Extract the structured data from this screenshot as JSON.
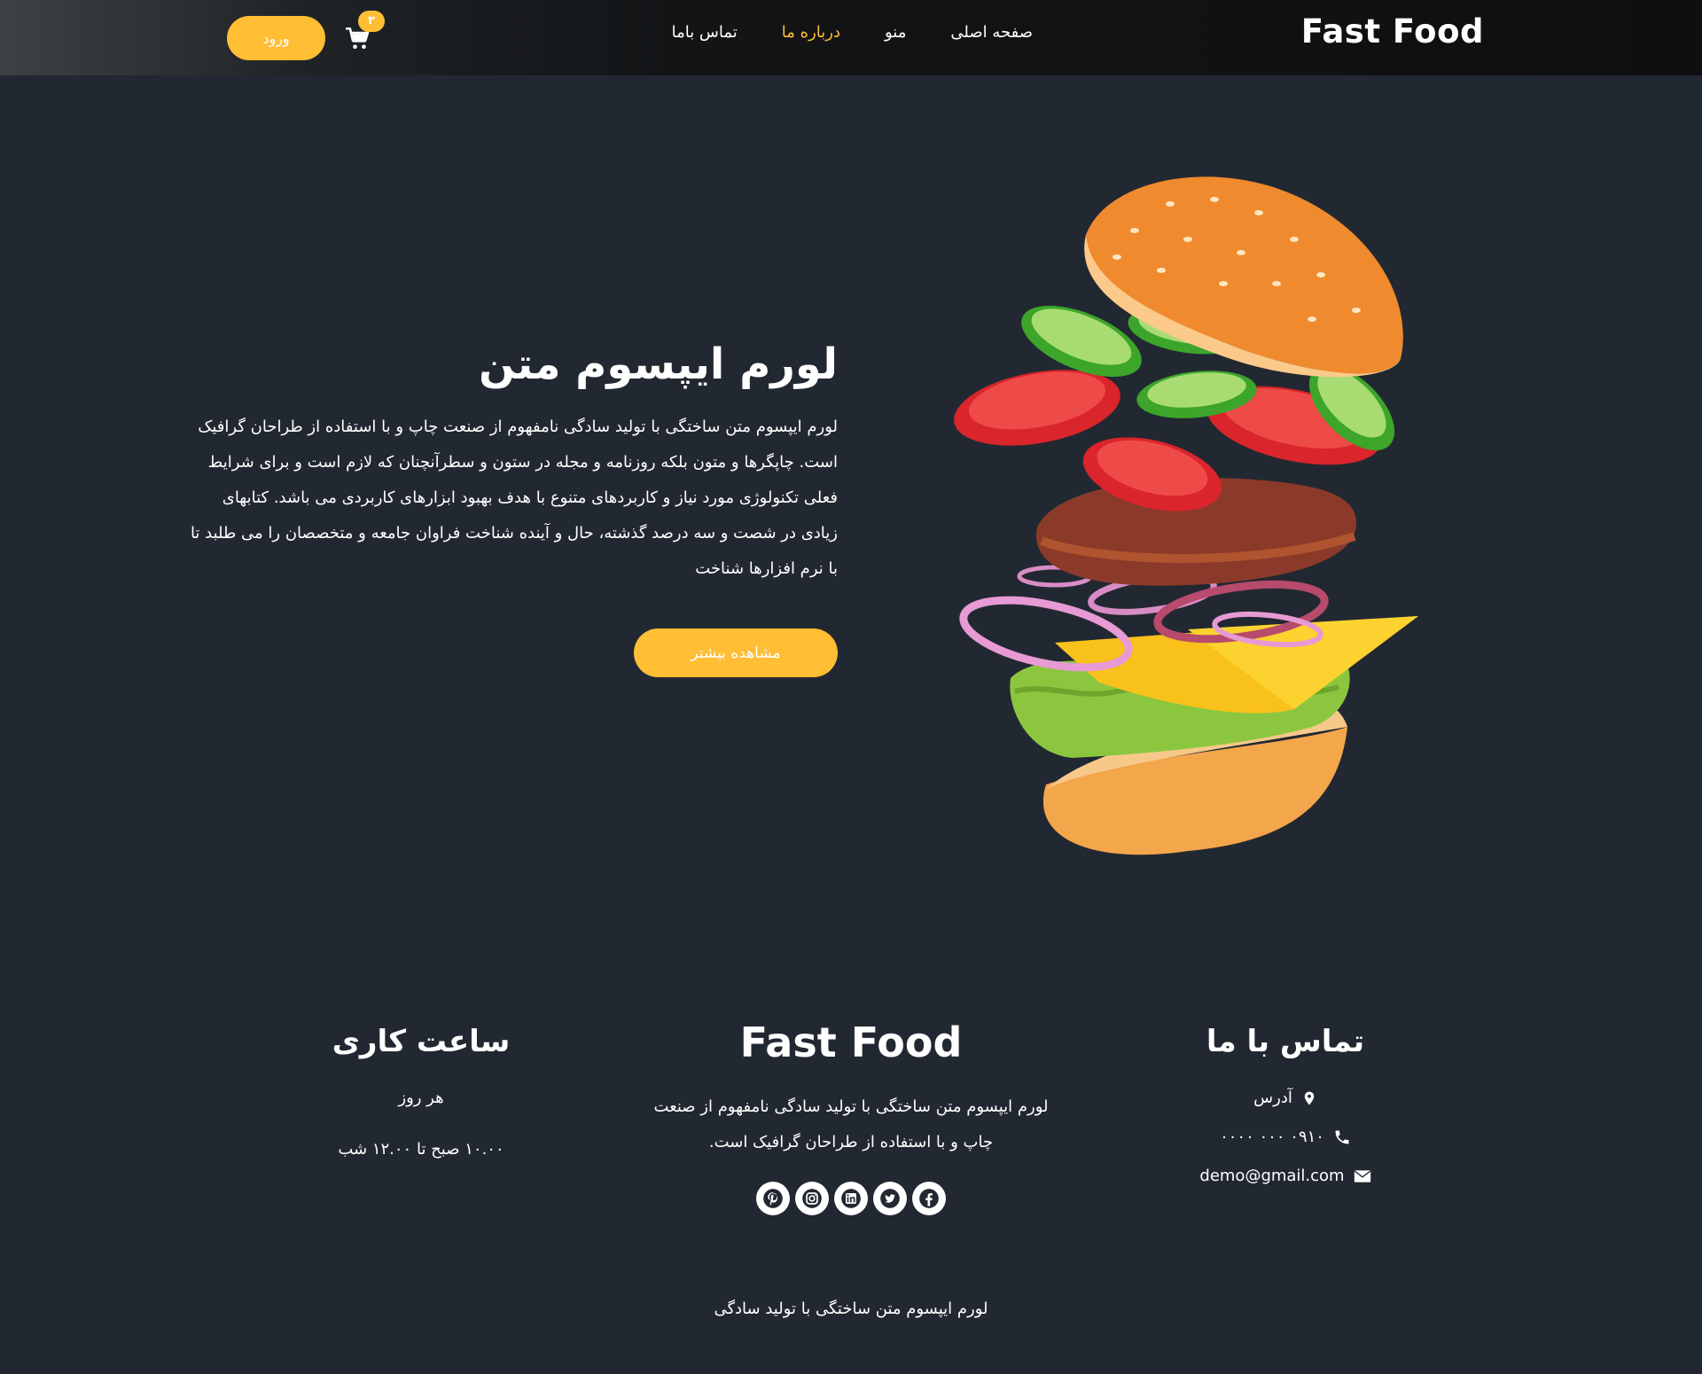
{
  "header": {
    "brand": "Fast Food",
    "nav": [
      {
        "label": "صفحه اصلی",
        "active": false
      },
      {
        "label": "منو",
        "active": false
      },
      {
        "label": "درباره ما",
        "active": true
      },
      {
        "label": "تماس باما",
        "active": false
      }
    ],
    "cart_count": "۳",
    "login_label": "ورود",
    "accent_color": "#ffbe33"
  },
  "hero": {
    "title": "لورم ایپسوم متن",
    "description": "لورم ایپسوم متن ساختگی با تولید سادگی نامفهوم از صنعت چاپ و با استفاده از طراحان گرافیک است. چاپگرها و متون بلکه روزنامه و مجله در ستون و سطرآنچنان که لازم است و برای شرایط فعلی تکنولوژی مورد نیاز و کاربردهای متنوع با هدف بهبود ابزارهای کاربردی می باشد. کتابهای زیادی در شصت و سه درصد گذشته، حال و آینده شناخت فراوان جامعه و متخصصان را می طلبد تا با نرم افزارها شناخت",
    "button_label": "مشاهده بیشتر",
    "image": "burger-illustration"
  },
  "footer": {
    "hours": {
      "title": "ساعت کاری",
      "days": "هر روز",
      "time": "۱۰.۰۰ صبح تا ۱۲.۰۰ شب"
    },
    "about": {
      "title": "Fast Food",
      "description": "لورم ایپسوم متن ساختگی با تولید سادگی نامفهوم از صنعت چاپ و با استفاده از طراحان گرافیک است.",
      "socials": [
        "pinterest-icon",
        "instagram-icon",
        "linkedin-icon",
        "twitter-icon",
        "facebook-icon"
      ]
    },
    "contact": {
      "title": "تماس با ما",
      "address": "آدرس",
      "phone": "۰۹۱۰ ۰۰۰ ۰۰۰۰",
      "email": "demo@gmail.com"
    },
    "copyright": "لورم ایپسوم متن ساختگی با تولید سادگی"
  }
}
